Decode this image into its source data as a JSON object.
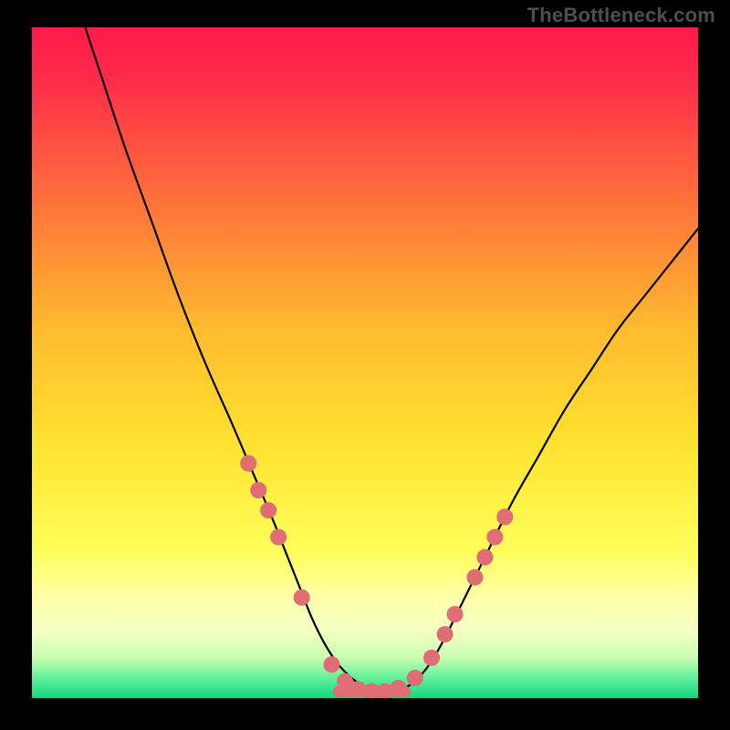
{
  "watermark": "TheBottleneck.com",
  "chart_data": {
    "type": "line",
    "title": "",
    "xlabel": "",
    "ylabel": "",
    "xlim": [
      0,
      100
    ],
    "ylim": [
      0,
      100
    ],
    "grid": false,
    "gradient_stops": [
      {
        "pos": 0.0,
        "color": "#ff1a4b"
      },
      {
        "pos": 0.08,
        "color": "#ff2c4a"
      },
      {
        "pos": 0.25,
        "color": "#ff6e3c"
      },
      {
        "pos": 0.45,
        "color": "#ffbb2e"
      },
      {
        "pos": 0.62,
        "color": "#ffe231"
      },
      {
        "pos": 0.78,
        "color": "#ffff59"
      },
      {
        "pos": 0.85,
        "color": "#ffffaa"
      },
      {
        "pos": 0.9,
        "color": "#f4ffc4"
      },
      {
        "pos": 0.94,
        "color": "#c8ffb0"
      },
      {
        "pos": 0.97,
        "color": "#63f09a"
      },
      {
        "pos": 1.0,
        "color": "#11d880"
      }
    ],
    "series": [
      {
        "name": "bottleneck-curve",
        "color": "#000000",
        "x": [
          8,
          10,
          14,
          18,
          22,
          26,
          30,
          33,
          36,
          38,
          40,
          42,
          44,
          46,
          48,
          50,
          52,
          54,
          56,
          58,
          60,
          62,
          64,
          68,
          72,
          76,
          80,
          84,
          88,
          92,
          96,
          100
        ],
        "y": [
          100,
          94,
          82,
          71,
          60,
          50,
          41,
          34,
          27,
          22,
          17,
          12,
          8,
          5,
          3,
          1.5,
          1,
          1,
          1.5,
          3,
          5.5,
          9,
          13,
          21,
          29,
          36,
          43,
          49,
          55,
          60,
          65,
          70
        ]
      }
    ],
    "markers": {
      "name": "highlight-dots",
      "color": "#e06c75",
      "radius": 9,
      "points": [
        {
          "x": 32.5,
          "y": 35
        },
        {
          "x": 34.0,
          "y": 31
        },
        {
          "x": 35.5,
          "y": 28
        },
        {
          "x": 37.0,
          "y": 24
        },
        {
          "x": 40.5,
          "y": 15
        },
        {
          "x": 45.0,
          "y": 5
        },
        {
          "x": 47.0,
          "y": 2.5
        },
        {
          "x": 49.0,
          "y": 1.3
        },
        {
          "x": 51.0,
          "y": 1
        },
        {
          "x": 53.0,
          "y": 1
        },
        {
          "x": 55.0,
          "y": 1.5
        },
        {
          "x": 57.5,
          "y": 3.0
        },
        {
          "x": 60.0,
          "y": 6
        },
        {
          "x": 62.0,
          "y": 9.5
        },
        {
          "x": 63.5,
          "y": 12.5
        },
        {
          "x": 66.5,
          "y": 18
        },
        {
          "x": 68.0,
          "y": 21
        },
        {
          "x": 69.5,
          "y": 24
        },
        {
          "x": 71.0,
          "y": 27
        }
      ]
    },
    "flat_segment": {
      "color": "#e06c75",
      "thickness": 12,
      "x1": 46,
      "x2": 56,
      "y": 1
    }
  }
}
